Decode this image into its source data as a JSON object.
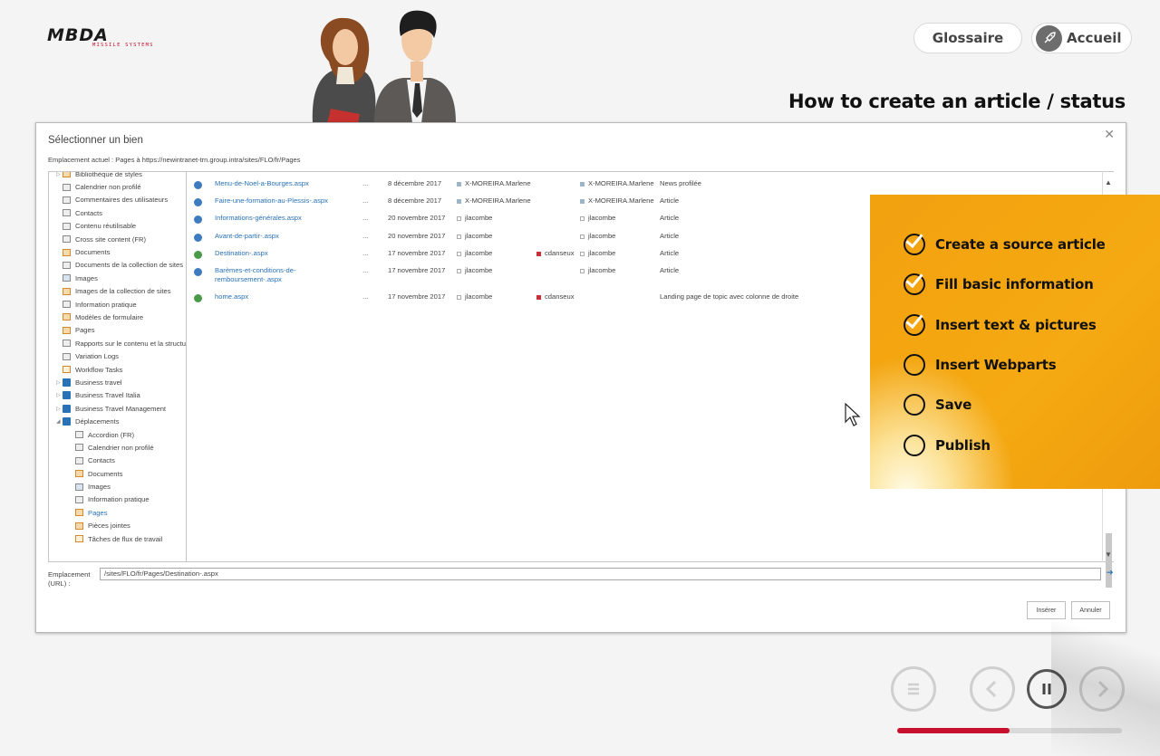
{
  "logo": {
    "word": "MBDA",
    "sub": "MISSILE SYSTEMS"
  },
  "header": {
    "glossary_label": "Glossaire",
    "home_label": "Accueil"
  },
  "headline": "How to create an article / status",
  "dialog": {
    "title": "Sélectionner un bien",
    "current_location": "Emplacement actuel : Pages à https://newintranet-trn.group.intra/sites/FLO/fr/Pages",
    "tree": [
      {
        "label": "Bibliothèque de styles",
        "icon": "library",
        "level": 0,
        "arrow": "▷"
      },
      {
        "label": "Calendrier non profilé",
        "icon": "list",
        "level": 0
      },
      {
        "label": "Commentaires des utilisateurs",
        "icon": "list",
        "level": 0
      },
      {
        "label": "Contacts",
        "icon": "list",
        "level": 0
      },
      {
        "label": "Contenu réutilisable",
        "icon": "list",
        "level": 0
      },
      {
        "label": "Cross site content (FR)",
        "icon": "list",
        "level": 0
      },
      {
        "label": "Documents",
        "icon": "library",
        "level": 0
      },
      {
        "label": "Documents de la collection de sites",
        "icon": "list",
        "level": 0
      },
      {
        "label": "Images",
        "icon": "image",
        "level": 0
      },
      {
        "label": "Images de la collection de sites",
        "icon": "library",
        "level": 0
      },
      {
        "label": "Information pratique",
        "icon": "list",
        "level": 0
      },
      {
        "label": "Modèles de formulaire",
        "icon": "library",
        "level": 0
      },
      {
        "label": "Pages",
        "icon": "library",
        "level": 0
      },
      {
        "label": "Rapports sur le contenu et la structure",
        "icon": "list",
        "level": 0
      },
      {
        "label": "Variation Logs",
        "icon": "list",
        "level": 0
      },
      {
        "label": "Workflow Tasks",
        "icon": "task",
        "level": 0
      },
      {
        "label": "Business travel",
        "icon": "site",
        "level": 0,
        "arrow": "▷"
      },
      {
        "label": "Business Travel Italia",
        "icon": "site",
        "level": 0,
        "arrow": "▷"
      },
      {
        "label": "Business Travel Management",
        "icon": "site",
        "level": 0,
        "arrow": "▷"
      },
      {
        "label": "Déplacements",
        "icon": "site",
        "level": 0,
        "arrow": "◢"
      },
      {
        "label": "Accordion (FR)",
        "icon": "list",
        "level": 1
      },
      {
        "label": "Calendrier non profilé",
        "icon": "list",
        "level": 1
      },
      {
        "label": "Contacts",
        "icon": "list",
        "level": 1
      },
      {
        "label": "Documents",
        "icon": "library",
        "level": 1
      },
      {
        "label": "Images",
        "icon": "image",
        "level": 1
      },
      {
        "label": "Information pratique",
        "icon": "list",
        "level": 1
      },
      {
        "label": "Pages",
        "icon": "library",
        "level": 1,
        "selected": true
      },
      {
        "label": "Pièces jointes",
        "icon": "library",
        "level": 1
      },
      {
        "label": "Tâches de flux de travail",
        "icon": "task",
        "level": 1
      }
    ],
    "rows": [
      {
        "name": "Menu-de-Noel-a-Bourges.aspx",
        "date": "8 décembre 2017",
        "author": "X-MOREIRA.Marlene",
        "checkout": "",
        "modified_by": "X-MOREIRA.Marlene",
        "type": "News profilée",
        "icon": "page",
        "author_mark": "b",
        "mod_mark": "b"
      },
      {
        "name": "Faire-une-formation-au-Plessis-.aspx",
        "date": "8 décembre 2017",
        "author": "X-MOREIRA.Marlene",
        "checkout": "",
        "modified_by": "X-MOREIRA.Marlene",
        "type": "Article",
        "icon": "page",
        "author_mark": "b",
        "mod_mark": "b"
      },
      {
        "name": "Informations-générales.aspx",
        "date": "20 novembre 2017",
        "author": "jlacombe",
        "checkout": "",
        "modified_by": "jlacombe",
        "type": "Article",
        "icon": "page",
        "author_mark": "",
        "mod_mark": ""
      },
      {
        "name": "Avant-de-partir-.aspx",
        "date": "20 novembre 2017",
        "author": "jlacombe",
        "checkout": "",
        "modified_by": "jlacombe",
        "type": "Article",
        "icon": "page",
        "author_mark": "",
        "mod_mark": ""
      },
      {
        "name": "Destination-.aspx",
        "date": "17 novembre 2017",
        "author": "jlacombe",
        "checkout": "cdanseux",
        "modified_by": "jlacombe",
        "type": "Article",
        "icon": "page-g",
        "author_mark": "",
        "mod_mark": ""
      },
      {
        "name": "Barèmes-et-conditions-de-remboursement-.aspx",
        "date": "17 novembre 2017",
        "author": "jlacombe",
        "checkout": "",
        "modified_by": "jlacombe",
        "type": "Article",
        "icon": "page",
        "author_mark": "",
        "mod_mark": ""
      },
      {
        "name": "home.aspx",
        "date": "17 novembre 2017",
        "author": "jlacombe",
        "checkout": "cdanseux",
        "modified_by": "",
        "type": "Landing page de topic avec colonne de droite",
        "icon": "page-g",
        "author_mark": "",
        "mod_mark": ""
      }
    ],
    "row_menu": "...",
    "location_label": "Emplacement (URL) :",
    "location_value": "/sites/FLO/fr/Pages/Destination-.aspx",
    "insert_label": "Insérer",
    "cancel_label": "Annuler"
  },
  "steps": [
    {
      "label": "Create a source article",
      "done": true
    },
    {
      "label": "Fill basic information",
      "done": true
    },
    {
      "label": "Insert text & pictures",
      "done": true
    },
    {
      "label": "Insert Webparts",
      "done": false
    },
    {
      "label": "Save",
      "done": false
    },
    {
      "label": "Publish",
      "done": false
    }
  ],
  "player": {
    "progress": 0.5
  },
  "colors": {
    "accent": "#c8102e",
    "panel": "#f5a912",
    "link": "#2a72b8"
  }
}
